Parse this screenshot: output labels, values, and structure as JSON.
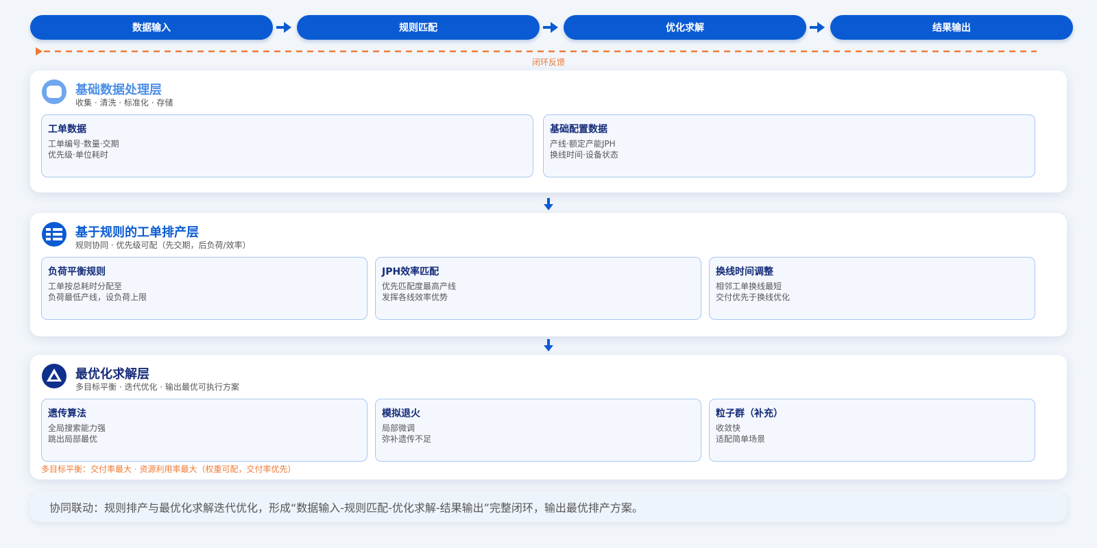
{
  "flow": {
    "steps": [
      "数据输入",
      "规则匹配",
      "优化求解",
      "结果输出"
    ],
    "feedback_label": "闭环反馈"
  },
  "layers": [
    {
      "title": "基础数据处理层",
      "subtitle": "收集 · 清洗 · 标准化 · 存储",
      "icon": "database-icon",
      "title_color": "#4d8fe8",
      "cards": [
        {
          "title": "工单数据",
          "lines": [
            "工单编号·数量·交期",
            "优先级·单位耗时"
          ]
        },
        {
          "title": "基础配置数据",
          "lines": [
            "产线·额定产能JPH",
            "换线时间·设备状态"
          ]
        }
      ]
    },
    {
      "title": "基于规则的工单排产层",
      "subtitle": "规则协同 · 优先级可配（先交期，后负荷/效率）",
      "icon": "rules-list-icon",
      "title_color": "#0a5bd3",
      "cards": [
        {
          "title": "负荷平衡规则",
          "lines": [
            "工单按总耗时分配至",
            "负荷最低产线，设负荷上限"
          ]
        },
        {
          "title": "JPH效率匹配",
          "lines": [
            "优先匹配度最高产线",
            "发挥各线效率优势"
          ]
        },
        {
          "title": "换线时间调整",
          "lines": [
            "相邻工单换线最短",
            "交付优先于换线优化"
          ]
        }
      ]
    },
    {
      "title": "最优化求解层",
      "subtitle": "多目标平衡 · 迭代优化 · 输出最优可执行方案",
      "icon": "triangle-optimize-icon",
      "title_color": "#142b78",
      "note": "多目标平衡：交付率最大 · 资源利用率最大（权重可配，交付率优先）",
      "cards": [
        {
          "title": "遗传算法",
          "lines": [
            "全局搜索能力强",
            "跳出局部最优"
          ]
        },
        {
          "title": "模拟退火",
          "lines": [
            "局部微调",
            "弥补遗传不足"
          ]
        },
        {
          "title": "粒子群（补充）",
          "lines": [
            "收敛快",
            "适配简单场景"
          ]
        }
      ]
    }
  ],
  "summary": "协同联动：规则排产与最优化求解迭代优化，形成“数据输入-规则匹配-优化求解-结果输出”完整闭环，输出最优排产方案。",
  "colors": {
    "primary": "#0a5bd3",
    "dark_blue": "#142b78",
    "feedback_orange": "#f07a34",
    "card_border": "#a7c6f2"
  }
}
